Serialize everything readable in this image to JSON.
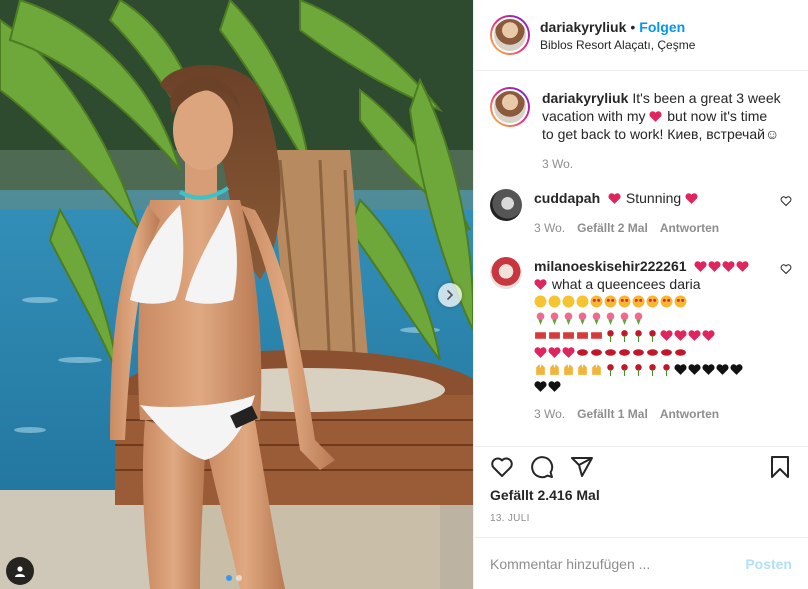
{
  "post": {
    "username": "dariakyryliuk",
    "separator": "•",
    "follow_label": "Folgen",
    "location": "Biblos Resort Alaçatı, Çeşme"
  },
  "caption": {
    "username": "dariakyryliuk",
    "text_before": "It's been a great 3 week vacation with my",
    "text_after": "but now it's time to get back to work! Киев, встречай☺",
    "time": "3 Wo."
  },
  "comments": [
    {
      "username": "cuddapah",
      "text": "Stunning",
      "time": "3 Wo.",
      "likes_label": "Gefällt 2 Mal",
      "reply_label": "Antworten"
    },
    {
      "username": "milanoeskisehir222261",
      "text": "what a queencees daria",
      "time": "3 Wo.",
      "likes_label": "Gefällt 1 Mal",
      "reply_label": "Antworten"
    }
  ],
  "likes": {
    "label": "Gefällt 2.416 Mal"
  },
  "date": {
    "label": "13. JULI"
  },
  "add_comment": {
    "placeholder": "Kommentar hinzufügen ...",
    "post_label": "Posten"
  },
  "colors": {
    "accent": "#0095f6",
    "heart": "#ed4956",
    "muted": "#8e8e8e",
    "carousel_active": "#3897f0"
  },
  "icons": [
    "chevron-right-icon",
    "user-tag-icon",
    "heart-icon",
    "comment-icon",
    "share-icon",
    "bookmark-icon"
  ]
}
